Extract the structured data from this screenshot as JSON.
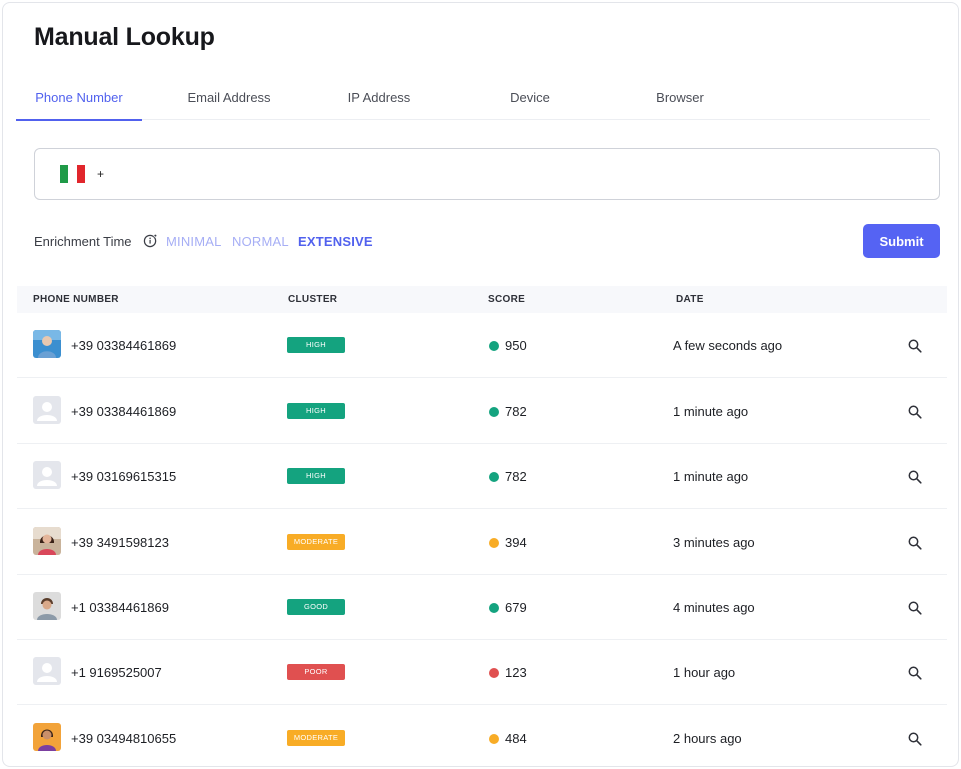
{
  "page": {
    "title": "Manual Lookup"
  },
  "tabs": [
    {
      "label": "Phone Number",
      "active": true
    },
    {
      "label": "Email Address",
      "active": false
    },
    {
      "label": "IP Address",
      "active": false
    },
    {
      "label": "Device",
      "active": false
    },
    {
      "label": "Browser",
      "active": false
    }
  ],
  "phone_input": {
    "country_flag": "italy-flag",
    "dial_prefix": "+",
    "value": ""
  },
  "enrichment": {
    "label": "Enrichment Time",
    "info_icon": "info-icon",
    "options": [
      {
        "label": "MINIMAL",
        "selected": false
      },
      {
        "label": "NORMAL",
        "selected": false
      },
      {
        "label": "EXTENSIVE",
        "selected": true
      }
    ]
  },
  "submit_label": "Submit",
  "table": {
    "headers": {
      "phone": "PHONE NUMBER",
      "cluster": "CLUSTER",
      "score": "SCORE",
      "date": "DATE"
    },
    "rows": [
      {
        "avatar": "photo",
        "phone": "+39 03384461869",
        "cluster": "HIGH",
        "cluster_color": "#14a37f",
        "score": "950",
        "score_color": "#14a37f",
        "date": "A few seconds ago"
      },
      {
        "avatar": "placeholder",
        "phone": "+39 03384461869",
        "cluster": "HIGH",
        "cluster_color": "#14a37f",
        "score": "782",
        "score_color": "#14a37f",
        "date": "1 minute ago"
      },
      {
        "avatar": "placeholder",
        "phone": "+39 03169615315",
        "cluster": "HIGH",
        "cluster_color": "#14a37f",
        "score": "782",
        "score_color": "#14a37f",
        "date": "1 minute ago"
      },
      {
        "avatar": "photo",
        "phone": "+39 3491598123",
        "cluster": "MODERATE",
        "cluster_color": "#f8ac26",
        "score": "394",
        "score_color": "#f8ac26",
        "date": "3 minutes ago"
      },
      {
        "avatar": "photo",
        "phone": "+1 03384461869",
        "cluster": "GOOD",
        "cluster_color": "#14a37f",
        "score": "679",
        "score_color": "#14a37f",
        "date": "4 minutes ago"
      },
      {
        "avatar": "placeholder",
        "phone": "+1 9169525007",
        "cluster": "POOR",
        "cluster_color": "#e05050",
        "score": "123",
        "score_color": "#e05050",
        "date": "1 hour ago"
      },
      {
        "avatar": "photo",
        "phone": "+39 03494810655",
        "cluster": "MODERATE",
        "cluster_color": "#f8ac26",
        "score": "484",
        "score_color": "#f8ac26",
        "date": "2 hours ago"
      }
    ]
  },
  "colors": {
    "accent": "#5161ee",
    "high": "#14a37f",
    "moderate": "#f8ac26",
    "poor": "#e05050"
  }
}
